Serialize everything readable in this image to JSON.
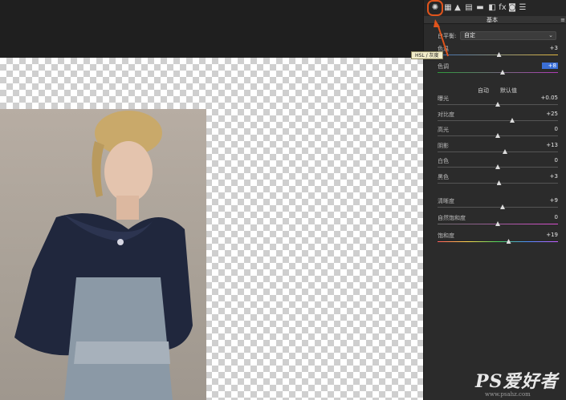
{
  "toolbar": {
    "icons": [
      "basic-icon",
      "tone-curve-icon",
      "detail-icon",
      "hsl-icon",
      "split-toning-icon",
      "lens-icon",
      "fx-icon",
      "camera-calibration-icon",
      "presets-icon"
    ],
    "fx_label": "fx",
    "tooltip": "HSL / 灰度"
  },
  "panel": {
    "title": "基本",
    "white_balance_label": "白平衡:",
    "white_balance_value": "自定",
    "auto_label": "自动",
    "default_label": "默认值",
    "sliders": [
      {
        "label": "色温",
        "value": "+3",
        "level": 0.51
      },
      {
        "label": "色调",
        "value": "+8",
        "level": 0.54,
        "highlight": true
      },
      {
        "label": "曝光",
        "value": "+0.05",
        "level": 0.5
      },
      {
        "label": "对比度",
        "value": "+25",
        "level": 0.62
      },
      {
        "label": "高光",
        "value": "0",
        "level": 0.5
      },
      {
        "label": "阴影",
        "value": "+13",
        "level": 0.56
      },
      {
        "label": "白色",
        "value": "0",
        "level": 0.5
      },
      {
        "label": "黑色",
        "value": "+3",
        "level": 0.51
      },
      {
        "label": "清晰度",
        "value": "+9",
        "level": 0.54
      },
      {
        "label": "自然饱和度",
        "value": "0",
        "level": 0.5
      },
      {
        "label": "饱和度",
        "value": "+19",
        "level": 0.59
      }
    ]
  },
  "watermark": {
    "big": "PS爱好者",
    "small": "www.psahz.com"
  },
  "colors": {
    "accent_orange": "#e0541c",
    "panel_bg": "#2b2b2b"
  }
}
